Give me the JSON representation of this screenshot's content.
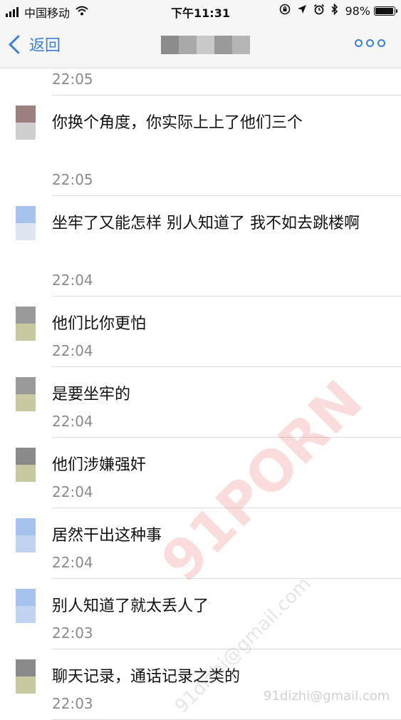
{
  "status_bar": {
    "carrier": "中国移动",
    "time": "下午11:31",
    "battery": "98%",
    "battery_level": 0.98,
    "icons": [
      "signal-icon",
      "wifi-icon",
      "rotation-lock-icon",
      "location-icon",
      "alarm-icon",
      "bluetooth-icon",
      "battery-icon"
    ]
  },
  "nav": {
    "back_label": "返回",
    "back_icon": "chevron-left-icon",
    "more_icon": "more-icon",
    "title_blur_colors": [
      "#8c8c8c",
      "#a9a9a9",
      "#c9c9c9",
      "#9a9a9a",
      "#b5b5b5"
    ],
    "accent": "#3b80d8"
  },
  "top_time": "22:05",
  "messages": [
    {
      "text": "你换个角度，你实际上上了他们三个",
      "time": "22:05",
      "avatar_colors": [
        "#9c7f7f",
        "#cfcfcf"
      ]
    },
    {
      "text": "坐牢了又能怎样 别人知道了 我不如去跳楼啊",
      "time": "22:04",
      "avatar_colors": [
        "#a8c2ee",
        "#dfe6f3"
      ]
    },
    {
      "text": "他们比你更怕",
      "time": "22:04",
      "avatar_colors": [
        "#9a9a9a",
        "#c8c9a0"
      ]
    },
    {
      "text": "是要坐牢的",
      "time": "22:04",
      "avatar_colors": [
        "#9a9a9a",
        "#c8c9a0"
      ]
    },
    {
      "text": "他们涉嫌强奸",
      "time": "22:04",
      "avatar_colors": [
        "#8a8a8a",
        "#c8c9a0"
      ]
    },
    {
      "text": "居然干出这种事",
      "time": "22:04",
      "avatar_colors": [
        "#a8c2ee",
        "#c2d3f0"
      ]
    },
    {
      "text": "别人知道了就太丢人了",
      "time": "22:03",
      "avatar_colors": [
        "#a8c2ee",
        "#c2d3f0"
      ]
    },
    {
      "text": "聊天记录，通话记录之类的",
      "time": "22:03",
      "avatar_colors": [
        "#8a8a8a",
        "#c8c9a0"
      ]
    }
  ],
  "watermarks": {
    "main": "91PORN",
    "email": "91dizhi@gmail.com",
    "corner": "91dizhi@gmail.com"
  }
}
